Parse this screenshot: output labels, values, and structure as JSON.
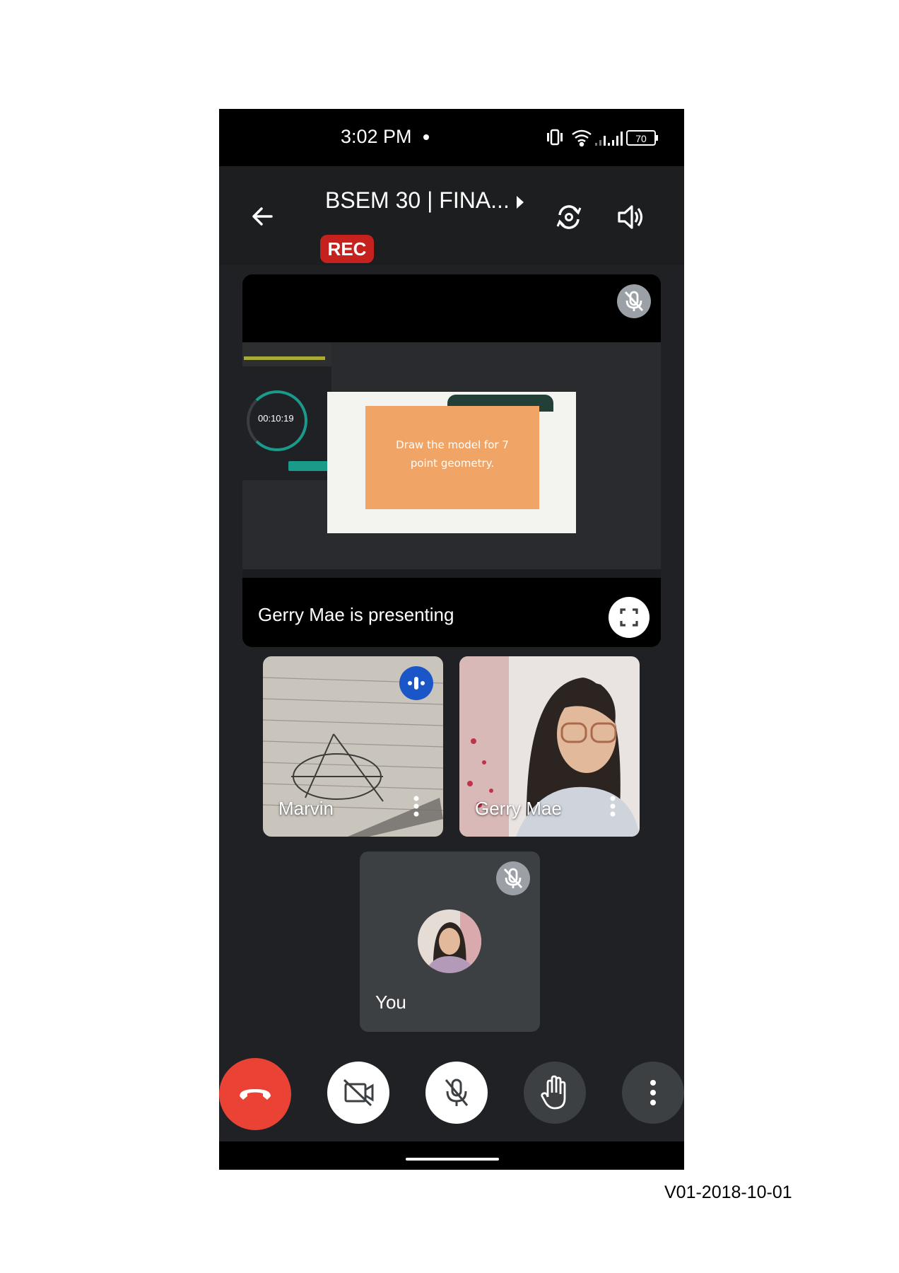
{
  "status_bar": {
    "time": "3:02 PM",
    "battery": "70"
  },
  "header": {
    "title": "BSEM 30 | FINA...",
    "rec_badge": "REC"
  },
  "presentation": {
    "caption": "Gerry Mae is presenting",
    "shared_screen": {
      "timer": "00:10:19",
      "slide_text_line1": "Draw the model for 7",
      "slide_text_line2": "point geometry."
    }
  },
  "participants": [
    {
      "name": "Marvin",
      "speaking": true
    },
    {
      "name": "Gerry Mae",
      "speaking": false
    }
  ],
  "self_tile": {
    "name": "You",
    "muted": true
  },
  "controls": [
    "end-call",
    "camera-off",
    "mic-off",
    "raise-hand",
    "more-options"
  ],
  "footer": {
    "version": "V01-2018-10-01"
  },
  "colors": {
    "end_call": "#ea4335",
    "rec": "#c5221f",
    "speaking_badge": "#1a56c8",
    "accent": "#1a9a8a"
  }
}
